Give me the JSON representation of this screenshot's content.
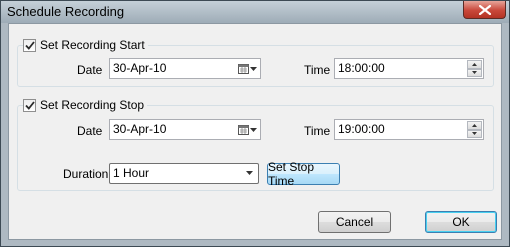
{
  "window": {
    "title": "Schedule Recording"
  },
  "start_group": {
    "checkbox_label": "Set Recording Start",
    "checked": true,
    "date_label": "Date",
    "date_value": "30-Apr-10",
    "time_label": "Time",
    "time_value": "18:00:00"
  },
  "stop_group": {
    "checkbox_label": "Set Recording Stop",
    "checked": true,
    "date_label": "Date",
    "date_value": "30-Apr-10",
    "time_label": "Time",
    "time_value": "19:00:00",
    "duration_label": "Duration",
    "duration_value": "1 Hour",
    "set_stop_time_label": "Set Stop Time"
  },
  "footer": {
    "cancel_label": "Cancel",
    "ok_label": "OK"
  },
  "icons": {
    "close": "close-icon",
    "checkbox": "checkmark-icon",
    "calendar": "calendar-icon",
    "dropdown": "chevron-down-icon",
    "spin_up": "spin-up-icon",
    "spin_down": "spin-down-icon"
  },
  "colors": {
    "close_button": "#c9483a",
    "focus_border": "#3c7fb1",
    "dialog_background": "#f0f0f0"
  }
}
